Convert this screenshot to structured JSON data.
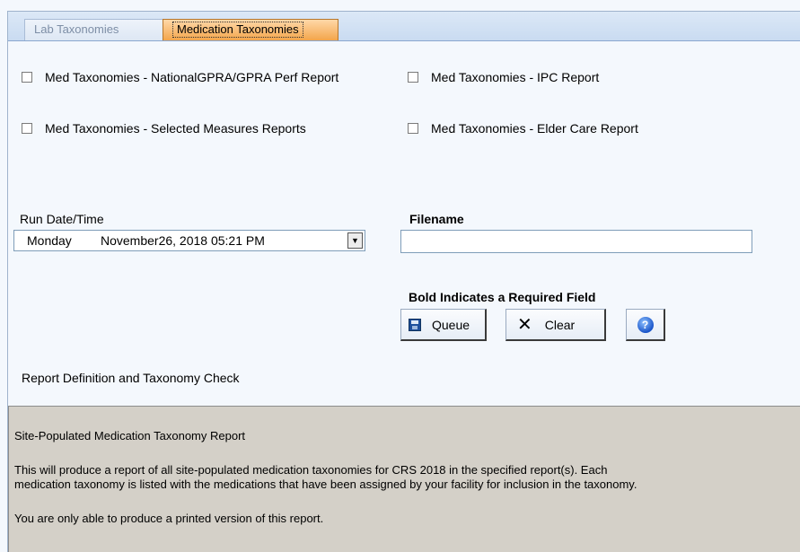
{
  "tabs": [
    {
      "label": "Lab Taxonomies"
    },
    {
      "label": "Medication Taxonomies"
    }
  ],
  "checkboxes": [
    {
      "label": "Med Taxonomies - NationalGPRA/GPRA Perf Report",
      "checked": false
    },
    {
      "label": "Med Taxonomies - IPC Report",
      "checked": false
    },
    {
      "label": "Med Taxonomies - Selected Measures Reports",
      "checked": false
    },
    {
      "label": "Med Taxonomies - Elder Care Report",
      "checked": false
    }
  ],
  "run_date": {
    "label": "Run Date/Time",
    "day": "Monday",
    "datetime": "November26, 2018  05:21 PM"
  },
  "filename": {
    "label": "Filename",
    "value": ""
  },
  "required_note": "Bold Indicates a Required Field",
  "buttons": {
    "queue": "Queue",
    "clear": "Clear",
    "help_icon": "help-icon"
  },
  "report_section_label": "Report Definition and Taxonomy Check",
  "description": {
    "title": "Site-Populated Medication Taxonomy Report",
    "line1": "This will produce a report of all site-populated medication taxonomies for CRS 2018 in the specified report(s).  Each",
    "line2": "medication taxonomy is listed with the medications that have been assigned by your facility for inclusion in the taxonomy.",
    "line3": "You are only able to produce a printed version of this report."
  },
  "colors": {
    "active_tab": "#f3a54b",
    "panel_bg": "#d4d0c8",
    "page_bg": "#f4f8fd"
  }
}
